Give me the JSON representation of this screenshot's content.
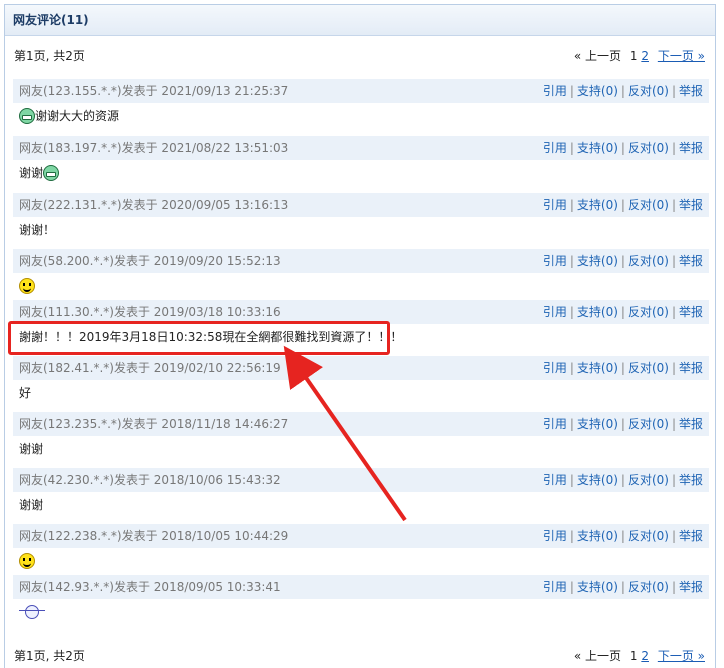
{
  "panel": {
    "title": "网友评论(11)"
  },
  "pager": {
    "info": "第1页, 共2页",
    "prev": "« 上一页",
    "page1": "1",
    "page2": "2",
    "next": "下一页 »"
  },
  "actions": {
    "quote": "引用",
    "support": "支持(0)",
    "oppose": "反对(0)",
    "report": "举报",
    "sep": "|"
  },
  "comments": [
    {
      "meta": "网友(123.155.*.*)发表于 2021/09/13 21:25:37",
      "text": "谢谢大大的资源",
      "emoticon": "green-grin"
    },
    {
      "meta": "网友(183.197.*.*)发表于 2021/08/22 13:51:03",
      "text": "谢谢",
      "emoticon": "green-grin-after"
    },
    {
      "meta": "网友(222.131.*.*)发表于 2020/09/05 13:16:13",
      "text": "谢谢！",
      "emoticon": ""
    },
    {
      "meta": "网友(58.200.*.*)发表于 2019/09/20 15:52:13",
      "text": "",
      "emoticon": "smiley"
    },
    {
      "meta": "网友(111.30.*.*)发表于 2019/03/18 10:33:16",
      "text": "謝謝！！！2019年3月18日10:32:58現在全網都很難找到資源了！！！",
      "emoticon": ""
    },
    {
      "meta": "网友(182.41.*.*)发表于 2019/02/10 22:56:19",
      "text": "好",
      "emoticon": ""
    },
    {
      "meta": "网友(123.235.*.*)发表于 2018/11/18 14:46:27",
      "text": "谢谢",
      "emoticon": ""
    },
    {
      "meta": "网友(42.230.*.*)发表于 2018/10/06 15:43:32",
      "text": "谢谢",
      "emoticon": ""
    },
    {
      "meta": "网友(122.238.*.*)发表于 2018/10/05 10:44:29",
      "text": "",
      "emoticon": "smiley"
    },
    {
      "meta": "网友(142.93.*.*)发表于 2018/09/05 10:33:41",
      "text": "",
      "emoticon": "ghost"
    }
  ],
  "colors": {
    "highlight": "#e62420",
    "link": "#1f64b4",
    "meta_bg": "#eaf1f9"
  }
}
